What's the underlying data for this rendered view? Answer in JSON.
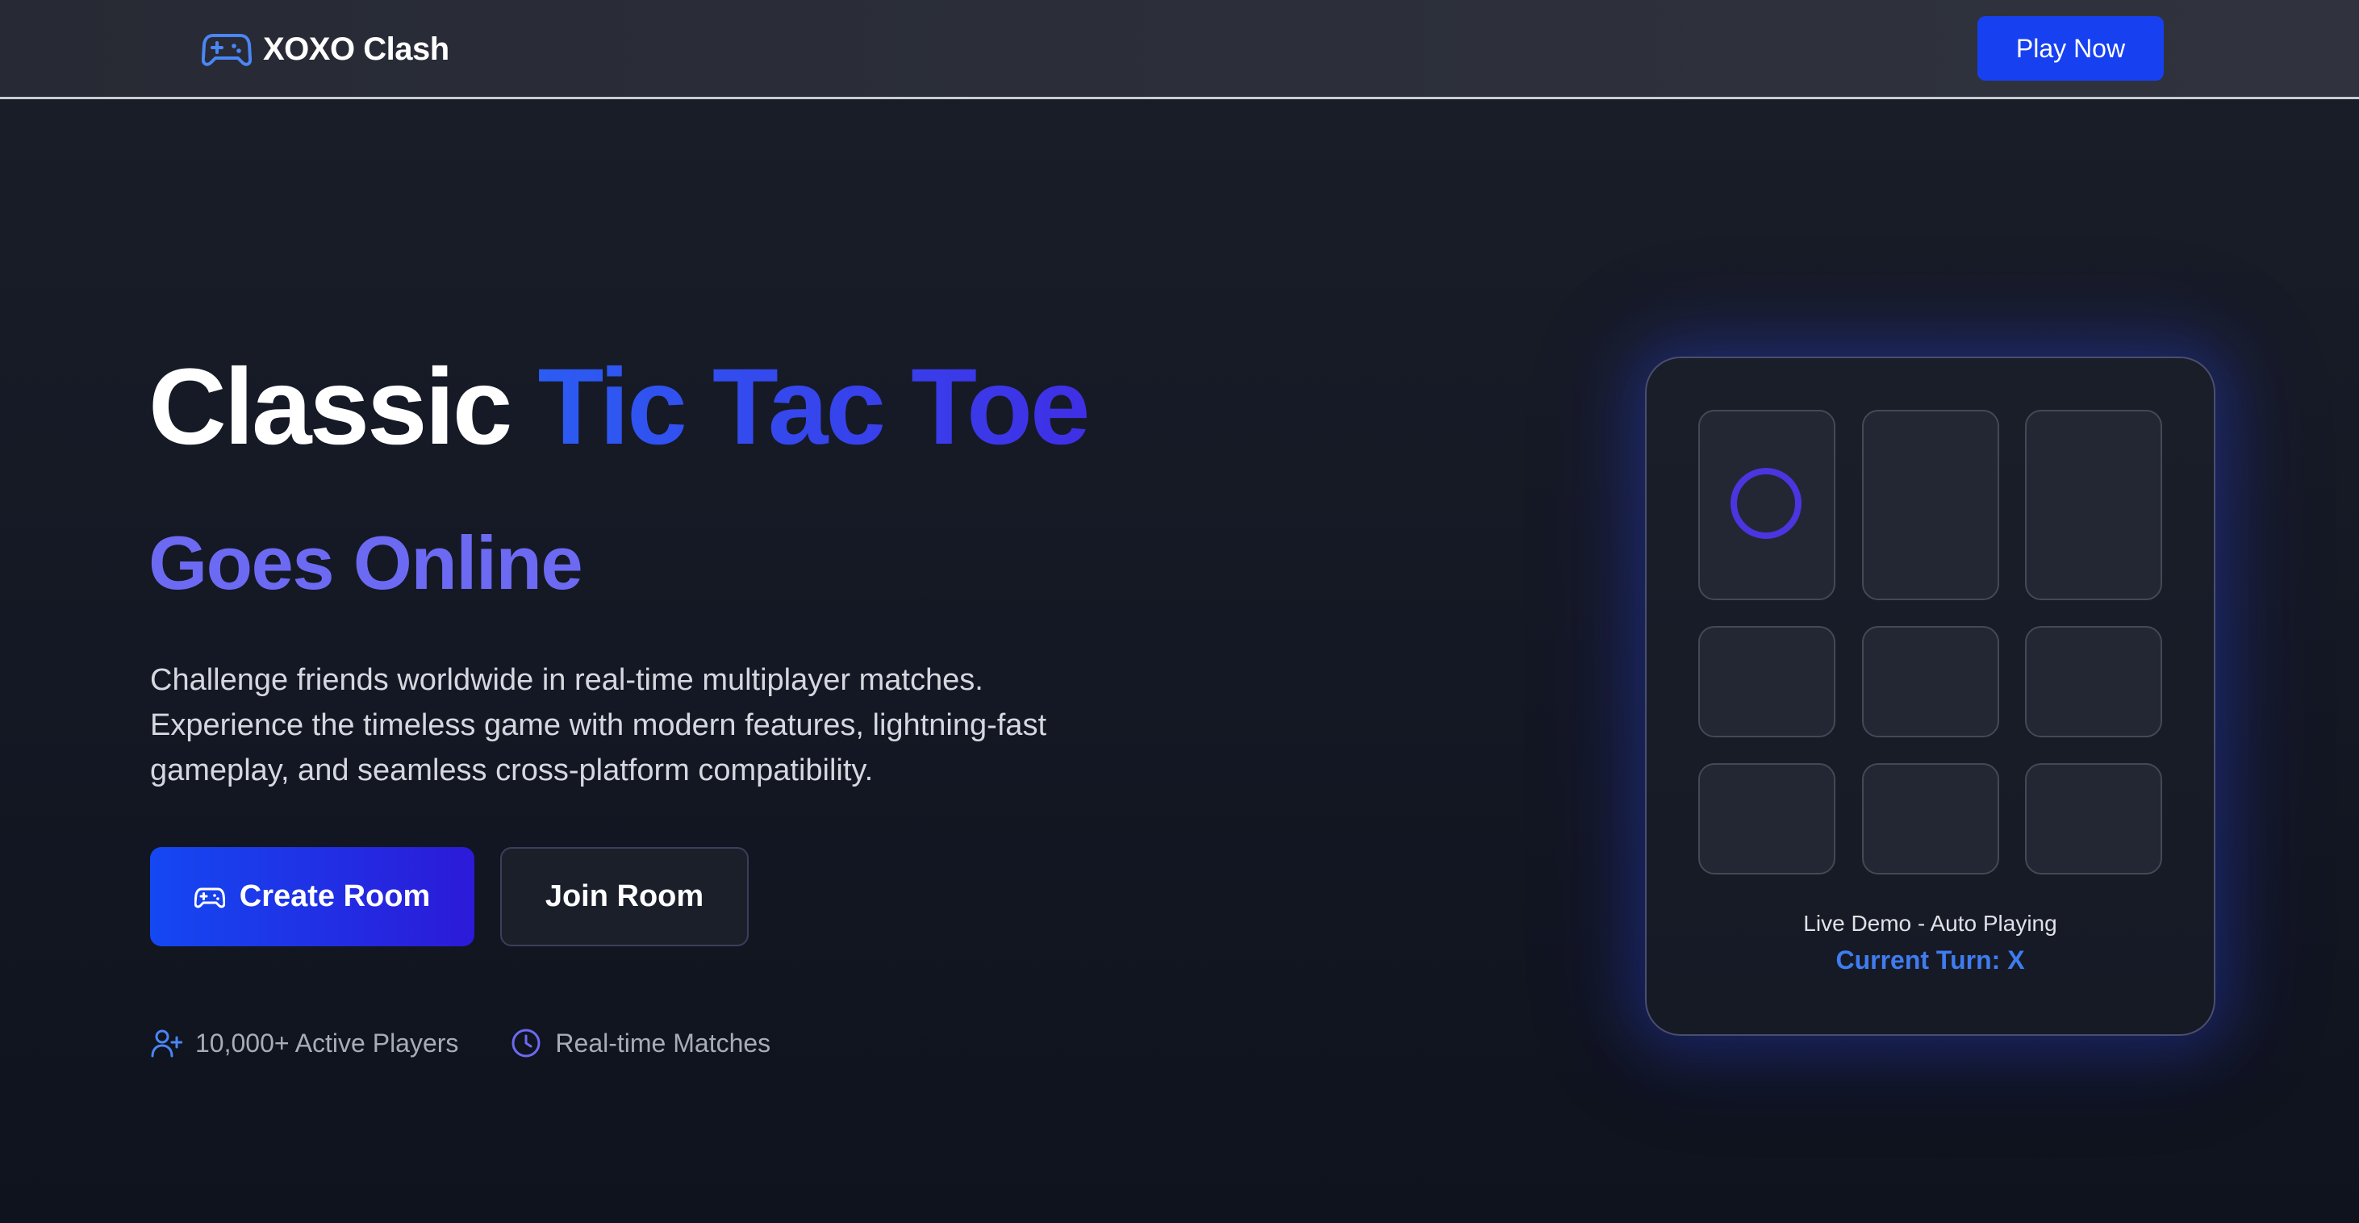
{
  "header": {
    "brand_name": "XOXO Clash",
    "play_now_label": "Play Now"
  },
  "hero": {
    "title_plain": "Classic",
    "title_accent": "Tic Tac Toe",
    "subtitle": "Goes Online",
    "description_lines": [
      "Challenge friends worldwide in real-time multiplayer matches.",
      "Experience the timeless game with modern features, lightning-fast",
      "gameplay, and seamless cross-platform compatibility."
    ],
    "create_room_label": "Create Room",
    "join_room_label": "Join Room",
    "stats": [
      {
        "icon": "user-plus-icon",
        "label": "10,000+ Active Players"
      },
      {
        "icon": "clock-icon",
        "label": "Real-time Matches"
      }
    ]
  },
  "demo": {
    "board": [
      "O",
      "",
      "",
      "",
      "",
      "",
      "",
      "",
      ""
    ],
    "status_label": "Live Demo - Auto Playing",
    "turn_label": "Current Turn: X"
  },
  "colors": {
    "accent_blue": "#1640f0",
    "accent_indigo": "#6c6af2",
    "o_mark": "#4b35e0",
    "turn_text": "#3f7cf0"
  }
}
